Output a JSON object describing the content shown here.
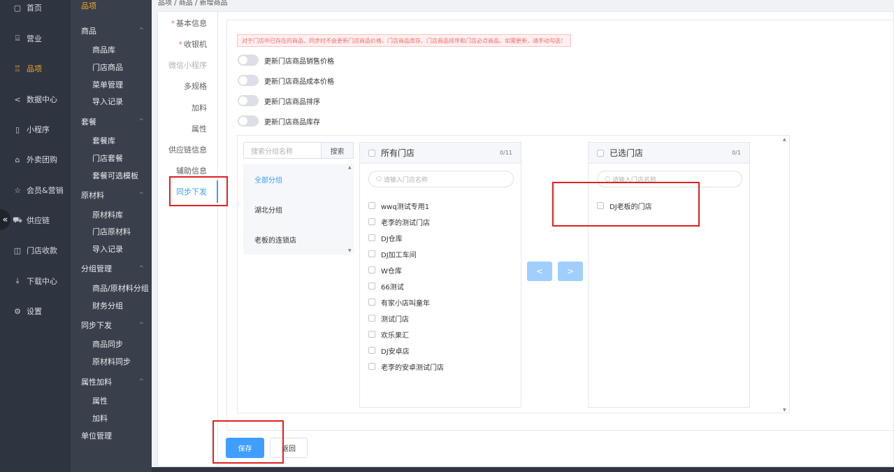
{
  "nav1": {
    "items": [
      {
        "label": "首页",
        "icon": "home-icon",
        "glyph": "▢"
      },
      {
        "label": "营业",
        "icon": "store-icon",
        "glyph": "⌸"
      },
      {
        "label": "品项",
        "icon": "product-icon",
        "glyph": "♖"
      },
      {
        "label": "数据中心",
        "icon": "share-icon",
        "glyph": "<"
      },
      {
        "label": "小程序",
        "icon": "phone-icon",
        "glyph": "▯"
      },
      {
        "label": "外卖团购",
        "icon": "bag-icon",
        "glyph": "⌂"
      },
      {
        "label": "会员&营销",
        "icon": "star-icon",
        "glyph": "☆"
      },
      {
        "label": "供应链",
        "icon": "truck-icon",
        "glyph": "⛟"
      },
      {
        "label": "门店收款",
        "icon": "book-icon",
        "glyph": "◫"
      },
      {
        "label": "下载中心",
        "icon": "download-icon",
        "glyph": "⤓"
      },
      {
        "label": "设置",
        "icon": "gear-icon",
        "glyph": "⚙"
      }
    ],
    "active_color": "#f5a623",
    "collapse_glyph": "«"
  },
  "nav2": {
    "top": "品项",
    "groups": [
      {
        "label": "商品",
        "items": [
          "商品库",
          "门店商品",
          "菜单管理",
          "导入记录"
        ]
      },
      {
        "label": "套餐",
        "items": [
          "套餐库",
          "门店套餐",
          "套餐可选模板"
        ]
      },
      {
        "label": "原材料",
        "items": [
          "原材料库",
          "门店原材料",
          "导入记录"
        ]
      },
      {
        "label": "分组管理",
        "items": [
          "商品/原材料分组",
          "财务分组"
        ]
      },
      {
        "label": "同步下发",
        "items": [
          "商品同步",
          "原材料同步"
        ]
      },
      {
        "label": "属性加料",
        "items": [
          "属性",
          "加料"
        ]
      }
    ],
    "last": "单位管理",
    "caret": "^"
  },
  "breadcrumb": "品项 / 商品 / 新增商品",
  "tabs": {
    "items": [
      {
        "label": "基本信息",
        "required": true
      },
      {
        "label": "收银机",
        "required": true
      },
      {
        "label": "微信小程序",
        "required": false
      },
      {
        "label": "多规格",
        "required": false
      },
      {
        "label": "加料",
        "required": false
      },
      {
        "label": "属性",
        "required": false
      },
      {
        "label": "供应链信息",
        "required": false
      },
      {
        "label": "辅助信息",
        "required": false
      },
      {
        "label": "同步下发",
        "required": false
      }
    ],
    "required_mark": "*",
    "active_color": "#409eff"
  },
  "notice": "对于门店中已存在的商品，同步时不会更新门店商品价格、门店商品库存、门店商品排序和门店必点商品。如需更新，请手动勾选！",
  "toggles": [
    "更新门店商品销售价格",
    "更新门店商品成本价格",
    "更新门店商品排序",
    "更新门店商品库存"
  ],
  "group_filter": {
    "placeholder": "搜索分组名称",
    "button": "搜索",
    "groups": [
      "全部分组",
      "湖北分组",
      "老板的连锁店"
    ]
  },
  "all_stores": {
    "title": "所有门店",
    "count": "0/11",
    "placeholder": "请输入门店名称",
    "stores": [
      "wwq测试专用1",
      "老李的测试门店",
      "DJ仓库",
      "DJ加工车间",
      "W仓库",
      "66测试",
      "有家小店叫童年",
      "测试门店",
      "欢乐果汇",
      "DJ安卓店",
      "老李的安卓测试门店"
    ]
  },
  "selected_stores": {
    "title": "已选门店",
    "count": "0/1",
    "placeholder": "请输入门店名称",
    "stores": [
      "DJ老板的门店"
    ]
  },
  "arrows": {
    "left": "<",
    "right": ">"
  },
  "search_glyph": "○",
  "scroll": {
    "up": "▲",
    "down": "▼"
  },
  "buttons": {
    "save": "保存",
    "back": "返回"
  },
  "colors": {
    "primary": "#409eff",
    "highlight": "#e02020",
    "warning": "#f56c6c"
  }
}
